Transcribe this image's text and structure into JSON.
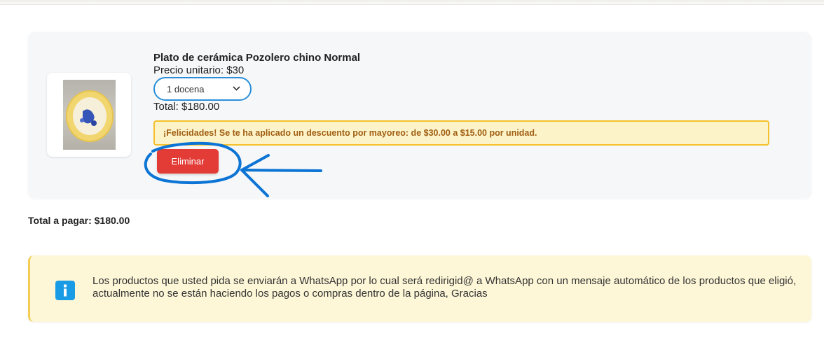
{
  "cart": {
    "item": {
      "name": "Plato de cerámica Pozolero chino Normal",
      "unit_price": "Precio unitario: $30",
      "quantity_selected": "1 docena",
      "total": "Total: $180.00",
      "discount_message": "¡Felicidades! Se te ha aplicado un descuento por mayoreo: de $30.00 a $15.00 por unidad.",
      "remove_label": "Eliminar"
    },
    "grand_total": "Total a pagar: $180.00"
  },
  "notice": {
    "icon": "info-icon",
    "text": "Los productos que usted pida se enviarán a WhatsApp por lo cual será redirigid@ a WhatsApp con un mensaje automático de los productos que eligió, actualmente no se están haciendo los pagos o compras dentro de la página, Gracias"
  },
  "colors": {
    "remove_button": "#e33b36",
    "select_border": "#2a8fd8",
    "discount_border": "#f5c02a",
    "discount_text": "#a05e12",
    "notice_bg": "#fdf7d7",
    "info_icon": "#1a9be6",
    "annotation": "#0b74d4"
  }
}
